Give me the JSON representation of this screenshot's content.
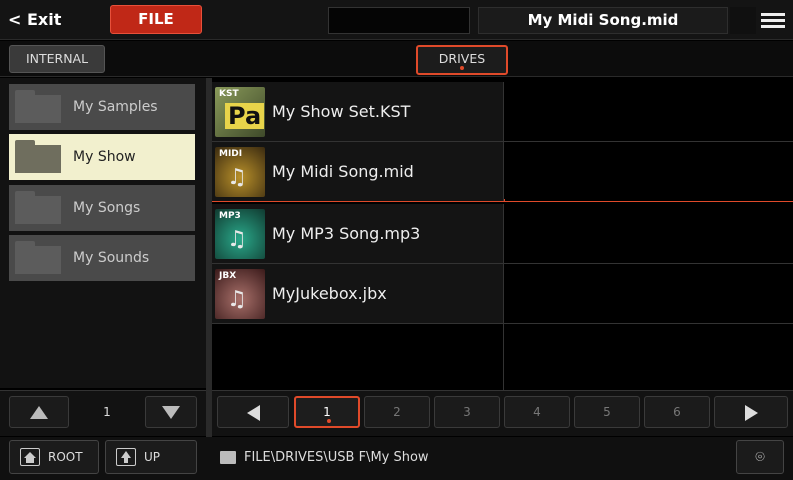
{
  "topbar": {
    "exit_label": "< Exit",
    "file_label": "FILE",
    "song_name": "My Midi Song.mid",
    "menu_icon": "hamburger-menu-icon"
  },
  "tabs": {
    "internal_label": "INTERNAL",
    "drives_label": "DRIVES"
  },
  "folders": [
    {
      "label": "My Samples",
      "selected": false
    },
    {
      "label": "My Show",
      "selected": true
    },
    {
      "label": "My Songs",
      "selected": false
    },
    {
      "label": "My Sounds",
      "selected": false
    }
  ],
  "files": [
    {
      "name": "My Show Set.KST",
      "icon_label": "KST",
      "icon_text": "Pa",
      "icon": "kst-set-icon"
    },
    {
      "name": "My Midi Song.mid",
      "icon_label": "MIDI",
      "icon": "midi-file-icon",
      "selected": true
    },
    {
      "name": "My MP3 Song.mp3",
      "icon_label": "MP3",
      "icon": "mp3-file-icon"
    },
    {
      "name": "MyJukebox.jbx",
      "icon_label": "JBX",
      "icon": "jukebox-file-icon"
    }
  ],
  "left_nav": {
    "page": "1"
  },
  "pager": {
    "pages": [
      "1",
      "2",
      "3",
      "4",
      "5",
      "6"
    ],
    "current": "1"
  },
  "footer": {
    "root_label": "ROOT",
    "up_label": "UP",
    "path": "FILE\\DRIVES\\USB F\\My Show"
  },
  "colors": {
    "accent": "#e04a2a",
    "file_tab_bg": "#c02817",
    "selected_folder": "#f2f0ce"
  }
}
